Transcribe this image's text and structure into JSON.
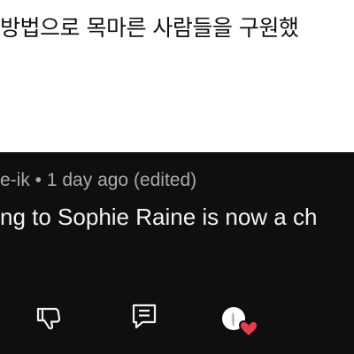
{
  "headline": {
    "text": "방법으로 목마른 사람들을 구원했"
  },
  "comment": {
    "meta": "e-ik • 1 day ago (edited)",
    "text": "ng to Sophie Raine is now a ch"
  },
  "actions": {
    "icons": [
      "like-icon",
      "dislike-icon",
      "reply-icon",
      "creator-heart-icon"
    ]
  },
  "colors": {
    "panel_bg": "#0f0f0f",
    "meta_text": "#aaaaaa",
    "comment_text": "#f1f1f1",
    "icon": "#f1f1f1",
    "heart": "#e53b55"
  }
}
